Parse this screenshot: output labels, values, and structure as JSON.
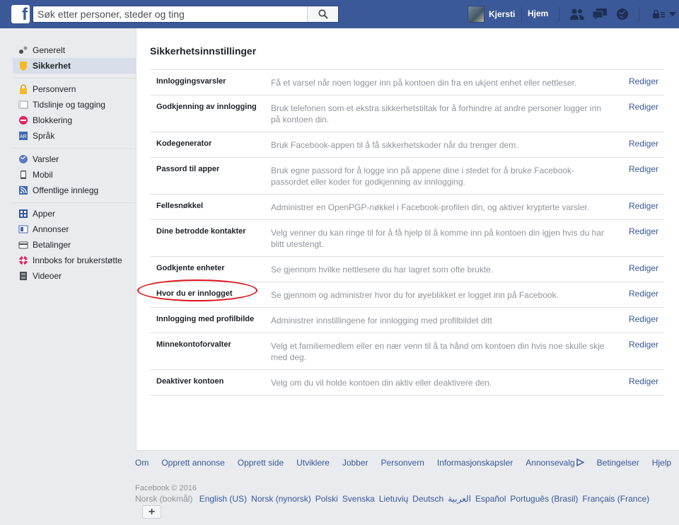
{
  "topbar": {
    "logo": "f",
    "search_placeholder": "Søk etter personer, steder og ting",
    "user_name": "Kjersti",
    "home": "Hjem",
    "icons": [
      "friends-icon",
      "messages-icon",
      "notifications-globe-icon",
      "privacy-lock-icon",
      "settings-chevron-icon"
    ]
  },
  "sidebar": {
    "groups": [
      [
        {
          "label": "Generelt",
          "icon": "gears-icon",
          "active": false
        },
        {
          "label": "Sikkerhet",
          "icon": "shield-icon",
          "active": true
        }
      ],
      [
        {
          "label": "Personvern",
          "icon": "lock-icon",
          "active": false
        },
        {
          "label": "Tidslinje og tagging",
          "icon": "timeline-icon",
          "active": false
        },
        {
          "label": "Blokkering",
          "icon": "block-icon",
          "active": false
        },
        {
          "label": "Språk",
          "icon": "language-icon",
          "active": false
        }
      ],
      [
        {
          "label": "Varsler",
          "icon": "globe-icon",
          "active": false
        },
        {
          "label": "Mobil",
          "icon": "mobile-icon",
          "active": false
        },
        {
          "label": "Offentlige innlegg",
          "icon": "rss-icon",
          "active": false
        }
      ],
      [
        {
          "label": "Apper",
          "icon": "apps-icon",
          "active": false
        },
        {
          "label": "Annonser",
          "icon": "ads-icon",
          "active": false
        },
        {
          "label": "Betalinger",
          "icon": "card-icon",
          "active": false
        },
        {
          "label": "Innboks for brukerstøtte",
          "icon": "lifebuoy-icon",
          "active": false
        },
        {
          "label": "Videoer",
          "icon": "film-icon",
          "active": false
        }
      ]
    ]
  },
  "main": {
    "title": "Sikkerhetsinnstillinger",
    "edit_label": "Rediger",
    "rows": [
      {
        "label": "Innloggingsvarsler",
        "desc": "Få et varsel når noen logger inn på kontoen din fra en ukjent enhet eller nettleser."
      },
      {
        "label": "Godkjenning av innlogging",
        "desc": "Bruk telefonen som et ekstra sikkerhetstiltak for å forhindre at andre personer logger inn på kontoen din."
      },
      {
        "label": "Kodegenerator",
        "desc": "Bruk Facebook-appen til å få sikkerhetskoder når du trenger dem."
      },
      {
        "label": "Passord til apper",
        "desc": "Bruk egne passord for å logge inn på appene dine i stedet for å bruke Facebook-passordet eller koder for godkjenning av innlogging."
      },
      {
        "label": "Fellesnøkkel",
        "desc": "Administrer en OpenPGP-nøkkel i Facebook-profilen din, og aktiver krypterte varsler."
      },
      {
        "label": "Dine betrodde kontakter",
        "desc": "Velg venner du kan ringe til for å få hjelp til å komme inn på kontoen din igjen hvis du har blitt utestengt."
      },
      {
        "label": "Godkjente enheter",
        "desc": "Se gjennom hvilke nettlesere du har lagret som ofte brukte."
      },
      {
        "label": "Hvor du er innlogget",
        "desc": "Se gjennom og administrer hvor du for øyeblikket er logget inn på Facebook."
      },
      {
        "label": "Innlogging med profilbilde",
        "desc": "Administrer innstillingene for innlogging med profilbildet ditt"
      },
      {
        "label": "Minnekontoforvalter",
        "desc": "Velg et familiemedlem eller en nær venn til å ta hånd om kontoen din hvis noe skulle skje med deg."
      },
      {
        "label": "Deaktiver kontoen",
        "desc": "Velg om du vil holde kontoen din aktiv eller deaktivere den."
      }
    ]
  },
  "footer": {
    "links": [
      "Om",
      "Opprett annonse",
      "Opprett side",
      "Utviklere",
      "Jobber",
      "Personvern",
      "Informasjonskapsler",
      "Annonsevalg",
      "Betingelser",
      "Hjelp"
    ],
    "copyright": "Facebook © 2016",
    "current_language": "Norsk (bokmål)",
    "languages": [
      "English (US)",
      "Norsk (nynorsk)",
      "Polski",
      "Svenska",
      "Lietuvių",
      "Deutsch",
      "العربية",
      "Español",
      "Português (Brasil)",
      "Français (France)"
    ],
    "plus": "+"
  },
  "colors": {
    "brand": "#3b5998",
    "link": "#365899",
    "highlight_ring": "#e0121b",
    "active_bg": "#d8dfea"
  }
}
